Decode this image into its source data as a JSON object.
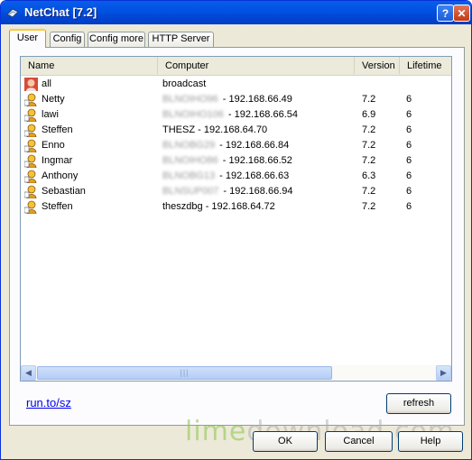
{
  "window": {
    "title": "NetChat [7.2]",
    "help_label": "?",
    "close_label": "✕"
  },
  "tabs": [
    {
      "label": "User",
      "active": true
    },
    {
      "label": "Config"
    },
    {
      "label": "Config more"
    },
    {
      "label": "HTTP Server"
    }
  ],
  "table": {
    "columns": [
      "Name",
      "Computer",
      "Version",
      "Lifetime"
    ],
    "rows": [
      {
        "icon": "avatar-icon",
        "name": "all",
        "host": "",
        "computer": "broadcast",
        "version": "",
        "lifetime": ""
      },
      {
        "icon": "user-icon",
        "name": "Netty",
        "host": "BLNOIHO96",
        "computer": " - 192.168.66.49",
        "version": "7.2",
        "lifetime": "6"
      },
      {
        "icon": "user-icon",
        "name": "lawi",
        "host": "BLNOIHO106",
        "computer": " - 192.168.66.54",
        "version": "6.9",
        "lifetime": "6"
      },
      {
        "icon": "user-icon",
        "name": "Steffen",
        "host": "",
        "computer": "THESZ - 192.168.64.70",
        "version": "7.2",
        "lifetime": "6"
      },
      {
        "icon": "user-icon",
        "name": "Enno",
        "host": "BLNOBG29",
        "computer": " - 192.168.66.84",
        "version": "7.2",
        "lifetime": "6"
      },
      {
        "icon": "user-icon",
        "name": "Ingmar",
        "host": "BLNOIHO86",
        "computer": " - 192.168.66.52",
        "version": "7.2",
        "lifetime": "6"
      },
      {
        "icon": "user-icon",
        "name": "Anthony",
        "host": "BLNOBG13",
        "computer": " - 192.168.66.63",
        "version": "6.3",
        "lifetime": "6"
      },
      {
        "icon": "user-icon",
        "name": "Sebastian",
        "host": "BLNSUP007",
        "computer": " - 192.168.66.94",
        "version": "7.2",
        "lifetime": "6"
      },
      {
        "icon": "user-icon",
        "name": "Steffen",
        "host": "",
        "computer": "theszdbg - 192.168.64.72",
        "version": "7.2",
        "lifetime": "6"
      }
    ]
  },
  "scrollbar": {
    "left_arrow": "◀",
    "right_arrow": "▶",
    "grip": "|||"
  },
  "link": "run.to/sz",
  "buttons": {
    "refresh": "refresh",
    "ok": "OK",
    "cancel": "Cancel",
    "help": "Help"
  },
  "watermark": {
    "part1": "lime",
    "part2": "download.com"
  }
}
